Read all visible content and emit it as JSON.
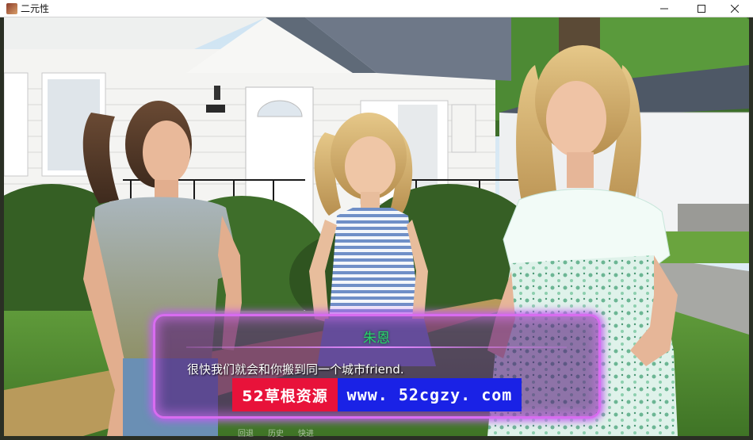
{
  "window": {
    "title": "二元性"
  },
  "icons": {
    "app": "app-icon",
    "minimize": "minimize-icon",
    "maximize": "maximize-icon",
    "close": "close-icon"
  },
  "dialogue": {
    "speaker": "朱恩",
    "text": "很快我们就会和你搬到同一个城市friend."
  },
  "watermark": {
    "site_name": "52草根资源",
    "url": "www. 52cgzy. com"
  },
  "quick_menu": {
    "items": [
      "回退",
      "历史",
      "快进"
    ]
  },
  "colors": {
    "speaker_name": "#27d36a",
    "textbox_border": "#d86cf0",
    "watermark_red": "#e8123a",
    "watermark_blue": "#1a22e6"
  }
}
